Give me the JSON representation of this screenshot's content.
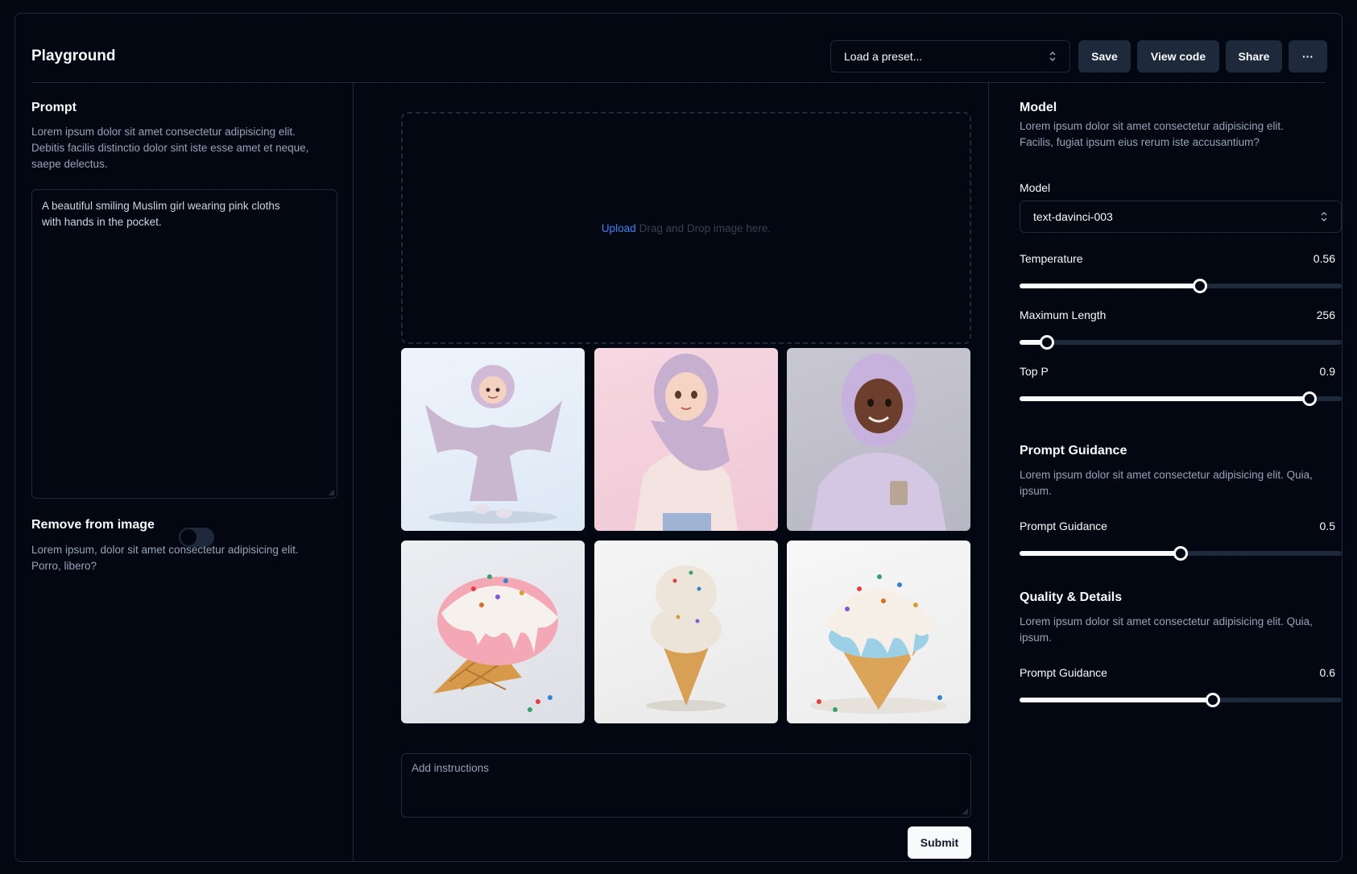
{
  "header": {
    "title": "Playground",
    "preset_placeholder": "Load a preset...",
    "save": "Save",
    "view_code": "View code",
    "share": "Share",
    "more": "···"
  },
  "left": {
    "prompt_title": "Prompt",
    "prompt_desc_1": "Lorem ipsum dolor sit amet consectetur adipisicing elit.",
    "prompt_desc_2": "Debitis facilis distinctio dolor sint iste esse amet et neque,",
    "prompt_desc_3": "saepe delectus.",
    "prompt_value_1": "A beautiful smiling Muslim girl wearing pink cloths",
    "prompt_value_2": "with hands in the pocket.",
    "remove_title": "Remove from image",
    "remove_desc_1": "Lorem ipsum, dolor sit amet consectetur adipisicing elit.",
    "remove_desc_2": "Porro, libero?"
  },
  "center": {
    "upload_link": "Upload",
    "upload_hint": "Drag and Drop image here.",
    "instructions_placeholder": "Add instructions",
    "submit": "Submit"
  },
  "right": {
    "model_title": "Model",
    "model_desc_1": "Lorem ipsum dolor sit amet consectetur adipisicing elit.",
    "model_desc_2": "Facilis, fugiat ipsum eius rerum iste accusantium?",
    "model_label": "Model",
    "model_value": "text-davinci-003",
    "temperature_label": "Temperature",
    "temperature_value": "0.56",
    "max_length_label": "Maximum Length",
    "max_length_value": "256",
    "top_p_label": "Top P",
    "top_p_value": "0.9",
    "guidance_title": "Prompt Guidance",
    "guidance_desc_1": "Lorem ipsum dolor sit amet consectetur adipisicing elit. Quia,",
    "guidance_desc_2": "ipsum.",
    "guidance_label": "Prompt Guidance",
    "guidance_value": "0.5",
    "quality_title": "Quality & Details",
    "quality_desc_1": "Lorem ipsum dolor sit amet consectetur adipisicing elit. Quia,",
    "quality_desc_2": "ipsum.",
    "quality_label": "Prompt Guidance",
    "quality_value": "0.6"
  },
  "sliders": {
    "temperature_fraction": 0.56,
    "max_length_fraction": 0.085,
    "top_p_fraction": 0.9,
    "guidance_fraction": 0.5,
    "quality_fraction": 0.6
  }
}
